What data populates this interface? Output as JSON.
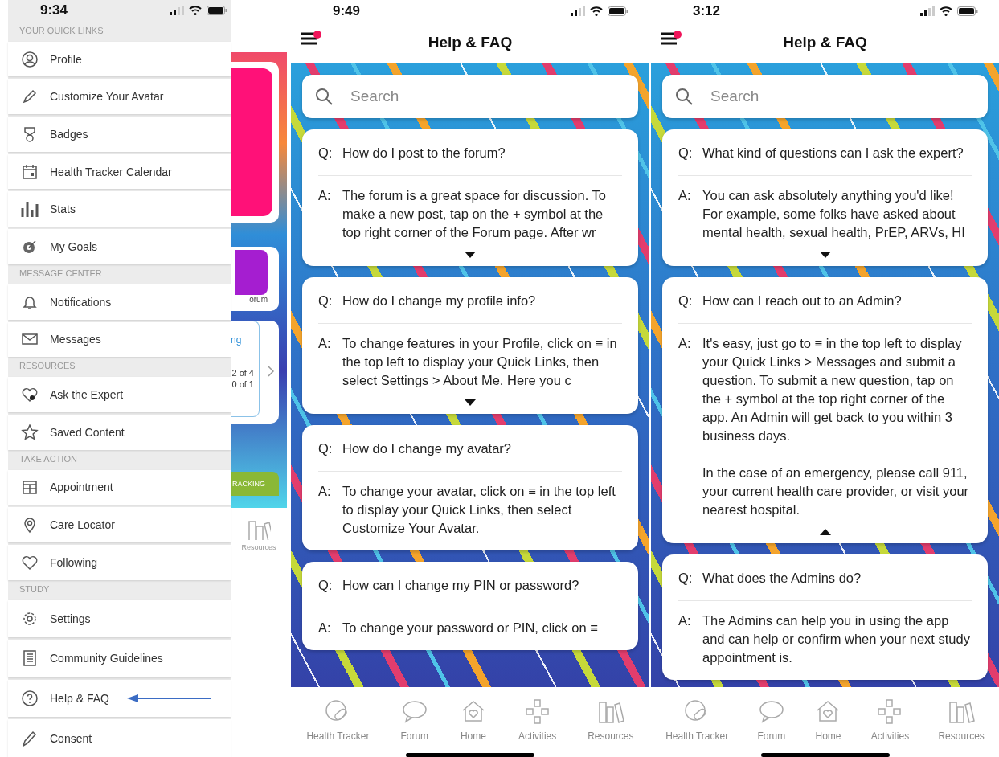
{
  "screens": [
    {
      "kind": "menu",
      "time": "9:34",
      "sections": [
        {
          "header": "YOUR QUICK LINKS",
          "items": [
            {
              "label": "Profile",
              "arrow": false
            },
            {
              "label": "Customize Your Avatar",
              "arrow": false
            },
            {
              "label": "Badges",
              "arrow": false
            },
            {
              "label": "Health Tracker Calendar",
              "arrow": false
            },
            {
              "label": "Stats",
              "arrow": false
            },
            {
              "label": "My Goals",
              "arrow": false
            }
          ]
        },
        {
          "header": "MESSAGE CENTER",
          "items": [
            {
              "label": "Notifications",
              "arrow": false
            },
            {
              "label": "Messages",
              "arrow": false
            }
          ]
        },
        {
          "header": "RESOURCES",
          "items": [
            {
              "label": "Ask the Expert",
              "arrow": false
            },
            {
              "label": "Saved Content",
              "arrow": false
            }
          ]
        },
        {
          "header": "TAKE ACTION",
          "items": [
            {
              "label": "Appointment",
              "arrow": false
            },
            {
              "label": "Care Locator",
              "arrow": false
            },
            {
              "label": "Following",
              "arrow": false
            }
          ]
        },
        {
          "header": "STUDY",
          "items": [
            {
              "label": "Settings",
              "arrow": false
            },
            {
              "label": "Community Guidelines",
              "arrow": false
            },
            {
              "label": "Help & FAQ",
              "arrow": true
            },
            {
              "label": "Consent",
              "arrow": false
            }
          ]
        }
      ],
      "background_app": {
        "forum_label": "orum",
        "card_text": "ng",
        "progress": [
          "2 of 4",
          "0 of 1"
        ],
        "banner": "RACKING",
        "tab_label": "Resources"
      }
    },
    {
      "kind": "faq",
      "time": "9:49",
      "title": "Help & FAQ",
      "menu_badge": true,
      "search": {
        "placeholder": "Search"
      },
      "faqs": [
        {
          "q_mark": "Q:",
          "question": "How do I post to the forum?",
          "a_mark": "A:",
          "answer": [
            "The forum is a great space for discussion. To make a new post, tap on the + symbol at the top right corner of the Forum page. After wr"
          ],
          "expanded": false
        },
        {
          "q_mark": "Q:",
          "question": "How do I change my profile info?",
          "a_mark": "A:",
          "answer": [
            "To change features in your Profile, click on ≡ in the top left to display your Quick Links, then select Settings > About Me. Here you c"
          ],
          "expanded": false
        },
        {
          "q_mark": "Q:",
          "question": "How do I change my avatar?",
          "a_mark": "A:",
          "answer": [
            "To change your avatar, click on ≡ in the top left to display your Quick Links, then select Customize Your Avatar."
          ]
        },
        {
          "q_mark": "Q:",
          "question": "How can I change my PIN or password?",
          "a_mark": "A:",
          "answer": [
            "To change your password or PIN, click on ≡"
          ]
        }
      ],
      "tabs": [
        "Health Tracker",
        "Forum",
        "Home",
        "Activities",
        "Resources"
      ]
    },
    {
      "kind": "faq",
      "time": "3:12",
      "title": "Help & FAQ",
      "menu_badge": true,
      "search": {
        "placeholder": "Search"
      },
      "faqs": [
        {
          "q_mark": "Q:",
          "question": "What kind of questions can I ask the expert?",
          "a_mark": "A:",
          "answer": [
            "You can ask absolutely anything you'd like! For example, some folks have asked about mental health, sexual health, PrEP, ARVs, HI"
          ],
          "expanded": false
        },
        {
          "q_mark": "Q:",
          "question": "How can I reach out to an Admin?",
          "a_mark": "A:",
          "answer": [
            "It's easy, just go to ≡ in the top left to display your Quick Links > Messages and submit a question. To submit a new question, tap on the + symbol at the top right corner of the app. An Admin will get back to you within 3 business days.",
            "In the case of an emergency, please call 911, your current health care provider, or visit your nearest hospital."
          ],
          "expanded": true
        },
        {
          "q_mark": "Q:",
          "question": "What does the Admins do?",
          "a_mark": "A:",
          "answer": [
            "The Admins can help you in using the app and can help or confirm when your next study appointment is."
          ]
        }
      ],
      "tabs": [
        "Health Tracker",
        "Forum",
        "Home",
        "Activities",
        "Resources"
      ]
    }
  ]
}
